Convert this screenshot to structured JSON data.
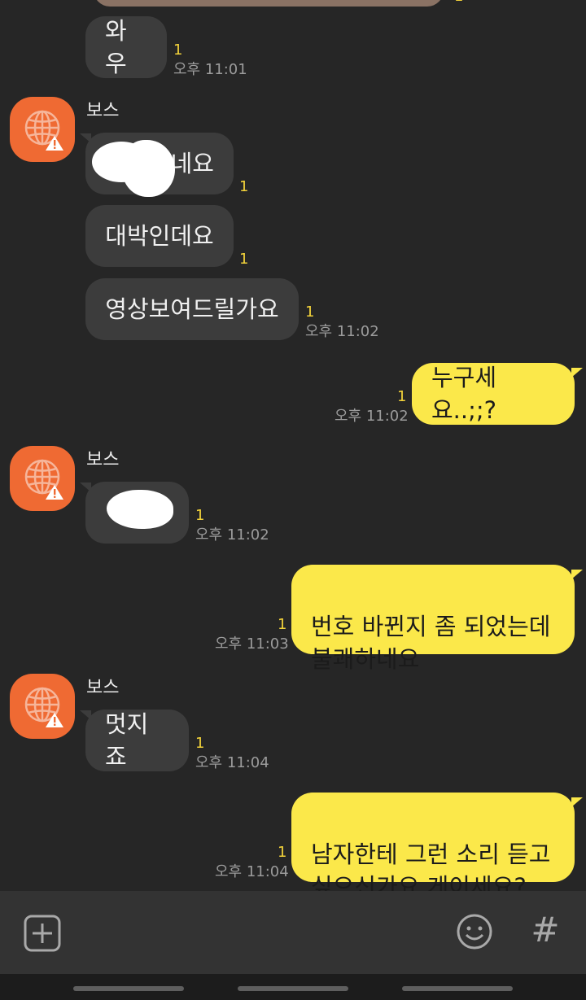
{
  "sender_name": "보스",
  "unread_count": "1",
  "composer": {
    "plus_icon": "plus-square-icon",
    "emoji_icon": "emoji-smile-icon",
    "hash_label": "#"
  },
  "messages": [
    {
      "side": "in",
      "text": "와우",
      "time": "오후 11:01"
    },
    {
      "side": "in",
      "text": "네요",
      "time": ""
    },
    {
      "side": "in",
      "text": "대박인데요",
      "time": ""
    },
    {
      "side": "in",
      "text": "영상보여드릴가요",
      "time": "오후 11:02"
    },
    {
      "side": "out",
      "text": "누구세요..;;?",
      "time": "오후 11:02"
    },
    {
      "side": "in",
      "text": "",
      "time": "오후 11:02"
    },
    {
      "side": "out",
      "text": "번호 바뀐지 좀 되었는데\n불쾌하네요",
      "time": "오후 11:03"
    },
    {
      "side": "in",
      "text": "멋지죠",
      "time": "오후 11:04"
    },
    {
      "side": "out",
      "text": "남자한테 그런 소리 듣고\n싶으신가요 게이세요?",
      "time": "오후 11:04"
    }
  ],
  "colors": {
    "background": "#262626",
    "incoming_bubble": "#3c3c3c",
    "outgoing_bubble": "#fbe84a",
    "avatar": "#ef6a33",
    "unread": "#f2d23a"
  }
}
